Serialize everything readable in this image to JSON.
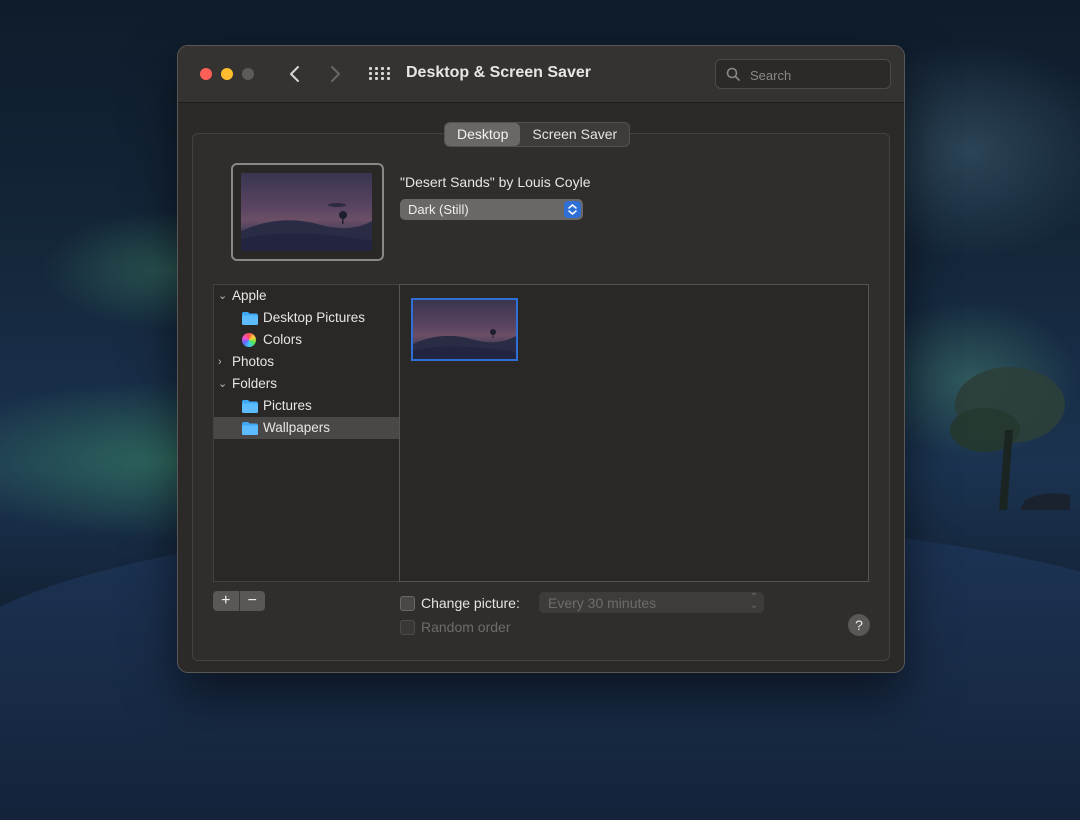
{
  "window": {
    "title": "Desktop & Screen Saver"
  },
  "toolbar": {
    "back_icon": "chevron-left-icon",
    "forward_icon": "chevron-right-icon",
    "grid_icon": "grid-icon"
  },
  "search": {
    "placeholder": "Search"
  },
  "tabs": [
    {
      "label": "Desktop",
      "active": true
    },
    {
      "label": "Screen Saver",
      "active": false
    }
  ],
  "wallpaper": {
    "title": "\"Desert Sands\" by Louis Coyle",
    "mode": "Dark (Still)"
  },
  "sidebar": {
    "items": [
      {
        "label": "Apple",
        "expanded": true
      },
      {
        "label": "Desktop Pictures",
        "icon": "folder-icon"
      },
      {
        "label": "Colors",
        "icon": "color-wheel-icon"
      },
      {
        "label": "Photos",
        "expanded": false
      },
      {
        "label": "Folders",
        "expanded": true
      },
      {
        "label": "Pictures",
        "icon": "folder-icon"
      },
      {
        "label": "Wallpapers",
        "icon": "folder-icon",
        "selected": true
      }
    ]
  },
  "footer": {
    "add_label": "+",
    "remove_label": "−",
    "change_picture_label": "Change picture:",
    "change_picture_checked": false,
    "interval": "Every 30 minutes",
    "random_order_label": "Random order",
    "random_order_checked": false,
    "help_label": "?"
  },
  "colors": {
    "accent": "#2f6fd6",
    "window_bg": "#2c2a29"
  }
}
